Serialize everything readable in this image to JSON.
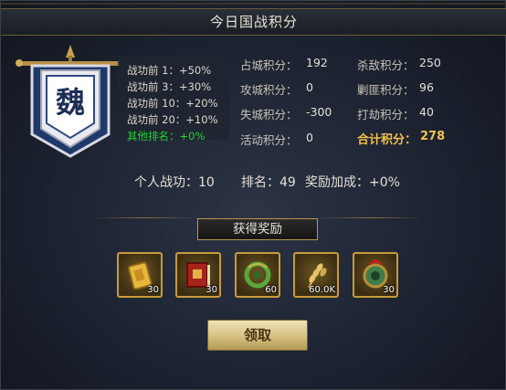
{
  "window": {
    "title": "今日国战积分"
  },
  "banner": {
    "character": "魏"
  },
  "rank_bonuses": [
    {
      "label": "战功前 1：",
      "value": "+50%"
    },
    {
      "label": "战功前 3：",
      "value": "+30%"
    },
    {
      "label": "战功前 10：",
      "value": "+20%"
    },
    {
      "label": "战功前 20：",
      "value": "+10%"
    },
    {
      "label": "其他排名：",
      "value": "+0%"
    }
  ],
  "stats": {
    "occupy": {
      "label": "占城积分：",
      "value": "192"
    },
    "attack": {
      "label": "攻城积分：",
      "value": "0"
    },
    "lose": {
      "label": "失城积分：",
      "value": "-300"
    },
    "activity": {
      "label": "活动积分：",
      "value": "0"
    },
    "kill": {
      "label": "杀敌积分：",
      "value": "250"
    },
    "bandit": {
      "label": "剿匪积分：",
      "value": "96"
    },
    "robbery": {
      "label": "打劫积分：",
      "value": "40"
    },
    "total": {
      "label": "合计积分：",
      "value": "278"
    }
  },
  "summary": {
    "merit": "个人战功：10",
    "rank": "排名：49",
    "bonus": "奖励加成：+0%"
  },
  "rewards": {
    "title": "获得奖励",
    "items": [
      {
        "icon": "gold-ingot-icon",
        "count": "30"
      },
      {
        "icon": "red-book-icon",
        "count": "30"
      },
      {
        "icon": "jade-dragon-icon",
        "count": "60"
      },
      {
        "icon": "wheat-grain-icon",
        "count": "60.0K"
      },
      {
        "icon": "jade-medallion-icon",
        "count": "30"
      }
    ]
  },
  "claim_button": {
    "label": "领取"
  },
  "colors": {
    "gold": "#f2c04a",
    "green": "#22d33b",
    "frame": "#c79b3b"
  }
}
